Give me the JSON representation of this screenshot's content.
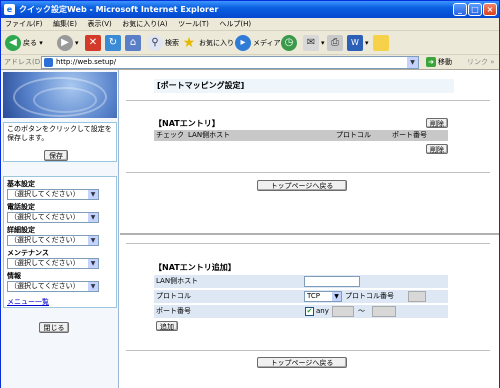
{
  "window": {
    "title": "クイック設定Web - Microsoft Internet Explorer"
  },
  "menubar": {
    "items": [
      "ファイル(F)",
      "編集(E)",
      "表示(V)",
      "お気に入り(A)",
      "ツール(T)",
      "ヘルプ(H)"
    ]
  },
  "toolbar": {
    "back": "戻る",
    "search": "検索",
    "favorites": "お気に入り",
    "media": "メディア"
  },
  "address": {
    "label": "アドレス(D)",
    "url": "http://web.setup/",
    "go": "移動",
    "links": "リンク"
  },
  "sidebar": {
    "save_text": "このボタンをクリックして設定を保存します。",
    "save_button": "保存",
    "groups": [
      {
        "title": "基本設定",
        "selected": "（選択してください）"
      },
      {
        "title": "電話設定",
        "selected": "（選択してください）"
      },
      {
        "title": "詳細設定",
        "selected": "（選択してください）"
      },
      {
        "title": "メンテナンス",
        "selected": "（選択してください）"
      },
      {
        "title": "情報",
        "selected": "（選択してください）"
      }
    ],
    "menu_link": "メニュー一覧",
    "close_button": "閉じる"
  },
  "main": {
    "page_title": "[ポートマッピング設定]",
    "nat_entry_title": "【NATエントリ】",
    "delete_button": "削除",
    "table_headers": [
      "チェック",
      "LAN側ホスト",
      "プロトコル",
      "ポート番号"
    ],
    "top_button": "トップページへ戻る",
    "add_title": "【NATエントリ追加】",
    "form": {
      "lan_host_label": "LAN側ホスト",
      "lan_host_value": "",
      "protocol_label": "プロトコル",
      "protocol_value": "TCP",
      "protocol_number_label": "プロトコル番号",
      "port_label": "ポート番号",
      "any_label": "any",
      "any_checked": true,
      "range_sep": "～"
    },
    "add_button": "追加"
  }
}
